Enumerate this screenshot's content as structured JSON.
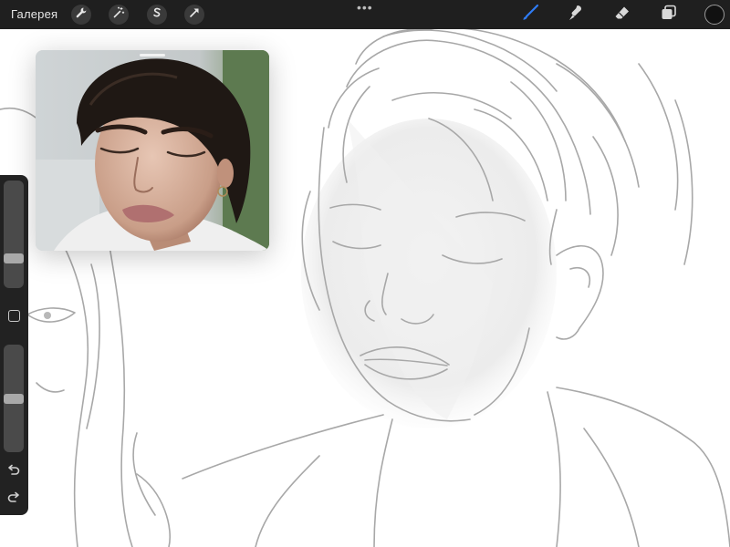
{
  "app": {
    "gallery_label": "Галерея",
    "more_label": "•••"
  },
  "toolbar": {
    "left_buttons": [
      "wrench-icon",
      "magic-wand-icon",
      "selection-s-icon",
      "arrow-transform-icon"
    ],
    "right_tools": [
      "brush-icon",
      "smudge-icon",
      "eraser-icon",
      "layers-icon"
    ],
    "active_tool": "brush-icon",
    "accent_color": "#2f7cf6",
    "current_color": "#111111"
  },
  "sidebar": {
    "brush_size_level": 0.25,
    "opacity_level": 0.5,
    "buttons": [
      "modify-square-icon",
      "undo-icon",
      "redo-icon"
    ]
  },
  "reference": {
    "content": "reference-photo"
  }
}
